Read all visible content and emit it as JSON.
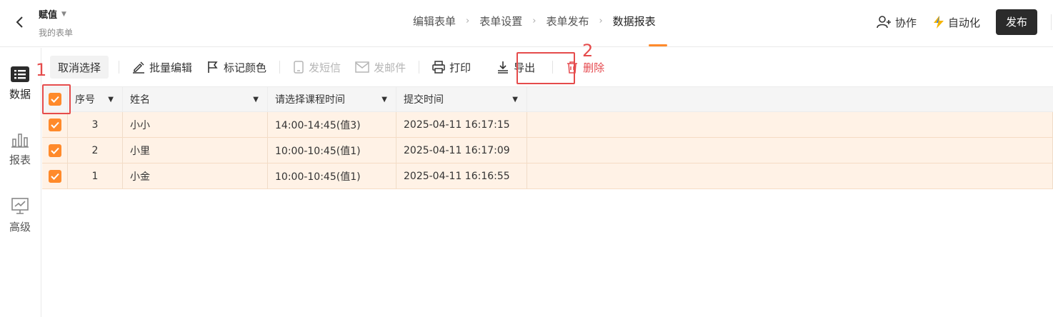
{
  "header": {
    "title": "赋值",
    "subtitle": "我的表单",
    "steps": [
      "编辑表单",
      "表单设置",
      "表单发布",
      "数据报表"
    ],
    "collab_label": "协作",
    "automation_label": "自动化",
    "publish_label": "发布"
  },
  "sidebar": {
    "items": [
      {
        "label": "数据",
        "icon": "list-icon"
      },
      {
        "label": "报表",
        "icon": "bar-chart-icon"
      },
      {
        "label": "高级",
        "icon": "presentation-icon"
      }
    ]
  },
  "toolbar": {
    "cancel_select": "取消选择",
    "batch_edit": "批量编辑",
    "mark_color": "标记颜色",
    "send_sms": "发短信",
    "send_email": "发邮件",
    "print": "打印",
    "export": "导出",
    "delete": "删除"
  },
  "annotations": {
    "one": "1",
    "two": "2"
  },
  "table": {
    "columns": [
      "序号",
      "姓名",
      "请选择课程时间",
      "提交时间"
    ],
    "rows": [
      {
        "seq": "3",
        "name": "小小",
        "course_time": "14:00-14:45(值3)",
        "submitted": "2025-04-11 16:17:15"
      },
      {
        "seq": "2",
        "name": "小里",
        "course_time": "10:00-10:45(值1)",
        "submitted": "2025-04-11 16:17:09"
      },
      {
        "seq": "1",
        "name": "小金",
        "course_time": "10:00-10:45(值1)",
        "submitted": "2025-04-11 16:16:55"
      }
    ]
  },
  "colors": {
    "accent": "#ff8a2b",
    "danger": "#e5484d",
    "annotation": "#e54b4b",
    "row_selected": "#fff2e6"
  }
}
